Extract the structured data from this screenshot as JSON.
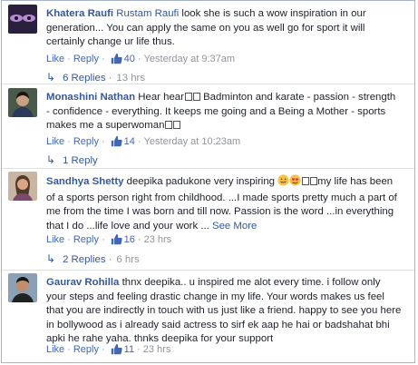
{
  "comments": [
    {
      "name": "Khatera Raufi",
      "tag": "Rustam Raufi",
      "text": " look she is such a wow inspiration in our generation... You can apply the same on you as well go for sport it will certainly change ur life thus.",
      "like": "Like",
      "reply": "Reply",
      "likes": "40",
      "time": "Yesterday at 9:37am",
      "replies": "6 Replies",
      "replies_time": "13 hrs"
    },
    {
      "name": "Monashini Nathan",
      "text_start": "Hear hear",
      "text_a": " Badminton and karate - passion - strength - confidence - everything. It keeps me going and a Being a Mother - sports makes me a superwoman",
      "like": "Like",
      "reply": "Reply",
      "likes": "14",
      "time": "Yesterday at 10:23am",
      "replies": "1 Reply"
    },
    {
      "name": "Sandhya Shetty",
      "text_start": "deepika padukone very inspiring ",
      "text_rest": "my life has been of a sports person right from childhood. ...I made sports pretty much a part of me from the time I was born and till now. Passion is the word ...in everything that I do ...life love and your work ...",
      "see_more": "See More",
      "like": "Like",
      "reply": "Reply",
      "likes": "16",
      "time": "23 hrs",
      "replies": "2 Replies",
      "replies_time": "6 hrs"
    },
    {
      "name": "Gaurav Rohilla",
      "text": " thnx deepika.. u inspired me alot every time. i follow only your steps and feeling drastic change in my life. Your words makes us feel that you are indirectly in touch with us just like a friend. happy to see you here in bollywood as i already said actress to sirf ek aap he hai or badshahat bhi apki he rahe yaha. thnks deepika for your support",
      "like": "Like",
      "reply": "Reply",
      "likes": "11",
      "time": "23 hrs"
    }
  ],
  "colors": {
    "name": "#365899",
    "link": "#4267b2",
    "meta": "#90949c",
    "border": "#a7b4c9"
  },
  "icons": [
    "thumbs-up-icon",
    "reply-arrow-icon",
    "smile-emoji-icon",
    "heart-eyes-emoji-icon"
  ]
}
